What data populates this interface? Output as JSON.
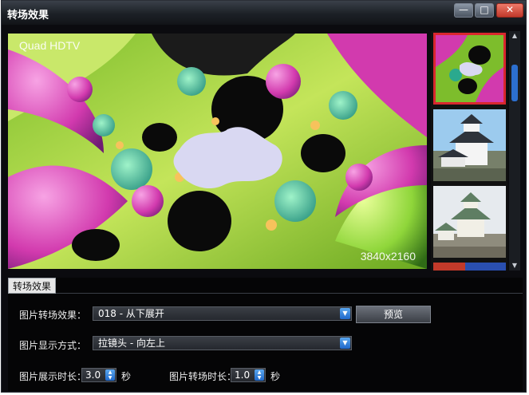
{
  "window": {
    "title": "转场效果",
    "controls": {
      "minimize": "—",
      "maximize": "□",
      "close": "✕"
    }
  },
  "preview": {
    "brand_label": "Quad HDTV",
    "resolution_label": "3840x2160"
  },
  "thumbnails": [
    {
      "name": "fractal",
      "selected": true
    },
    {
      "name": "castle-1",
      "selected": false
    },
    {
      "name": "castle-2",
      "selected": false
    },
    {
      "name": "partial",
      "selected": false
    }
  ],
  "scrollbar": {
    "up": "▲",
    "down": "▼"
  },
  "panel": {
    "tab_label": "转场效果",
    "effect_label": "图片转场效果：",
    "effect_value": "018 - 从下展开",
    "preview_button": "预览",
    "display_label": "图片显示方式：",
    "display_value": "拉镜头 - 向左上",
    "show_time_label": "图片展示时长：",
    "show_time_value": "3.0",
    "show_time_unit": "秒",
    "transition_time_label": "图片转场时长：",
    "transition_time_value": "1.0",
    "transition_time_unit": "秒",
    "dropdown_glyph": "▼",
    "spin_up": "▲",
    "spin_down": "▼"
  },
  "colors": {
    "selection_border": "#d9272e",
    "accent_blue": "#2c6fcf",
    "fractal_magenta": "#d33ab0",
    "fractal_green": "#7ed84a"
  }
}
